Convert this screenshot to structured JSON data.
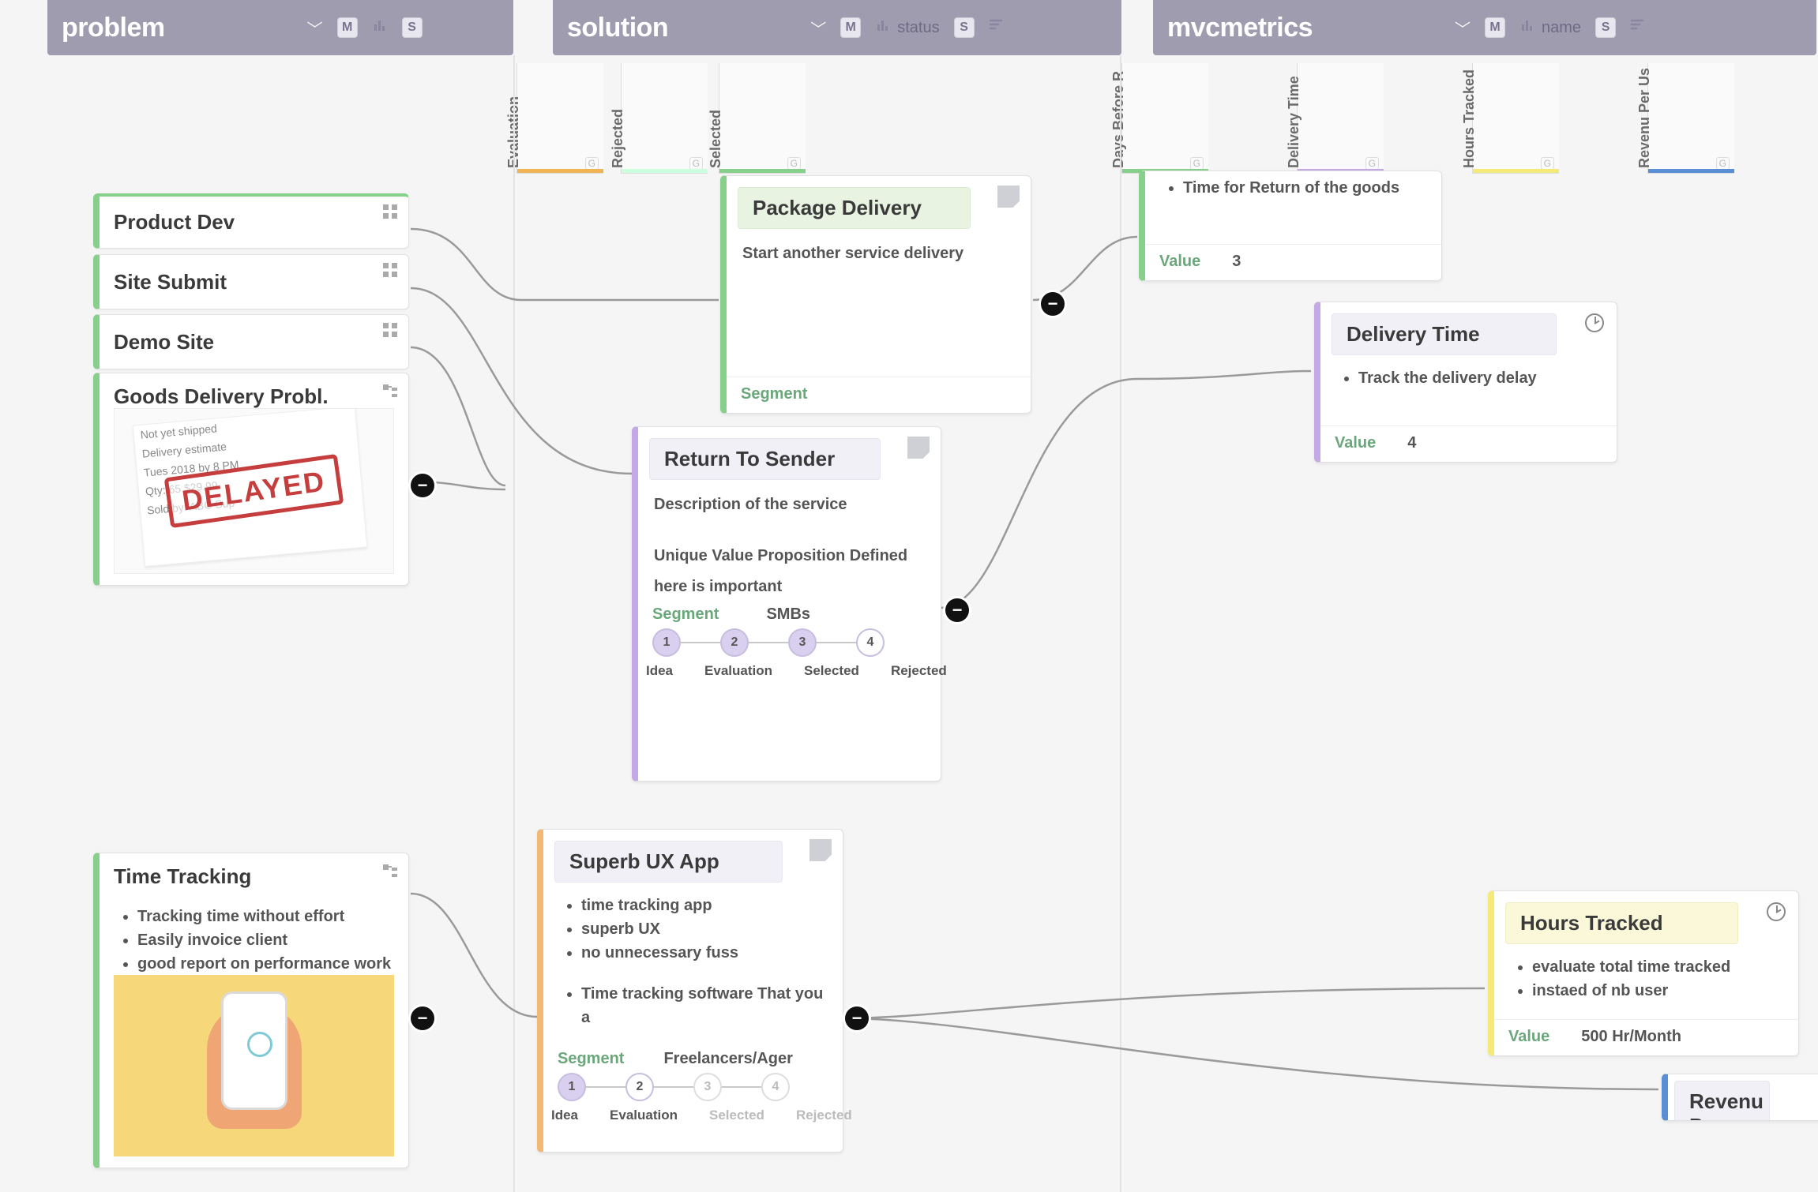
{
  "columns": {
    "problem": {
      "title": "problem",
      "badge_m": "M",
      "badge_s": "S"
    },
    "solution": {
      "title": "solution",
      "badge_m": "M",
      "badge_s": "S",
      "sort_label": "status"
    },
    "mvcmetrics": {
      "title": "mvcmetrics",
      "badge_m": "M",
      "badge_s": "S",
      "sort_label": "name"
    }
  },
  "sol_subcols": {
    "evaluation": "Evaluation",
    "rejected": "Rejected",
    "selected": "Selected"
  },
  "metric_subcols": {
    "days_before": "Days Before R",
    "delivery_time": "Delivery Time",
    "hours_tracked": "Hours Tracked",
    "revenu_per_user": "Revenu Per Us"
  },
  "problems": {
    "product_dev": "Product Dev",
    "site_submit": "Site Submit",
    "demo_site": "Demo Site",
    "goods_delivery": {
      "title": "Goods Delivery Probl.",
      "paper_lines": [
        "Not yet shipped",
        "Delivery estimate",
        "Tues 2018 by 8 PM",
        "Qty: 65   $29.99",
        "Sold by: ABC Sup"
      ],
      "stamp": "DELAYED"
    },
    "time_tracking": {
      "title": "Time Tracking",
      "bullets": [
        "Tracking time without effort",
        "Easily invoice client",
        "good report on performance work"
      ]
    }
  },
  "solutions": {
    "package_delivery": {
      "title": "Package Delivery",
      "text": "Start another service delivery",
      "segment_label": "Segment"
    },
    "return_to_sender": {
      "title": "Return To Sender",
      "desc": "Description of the service",
      "uvp": "Unique Value Proposition Defined",
      "note": "here is important",
      "segment_label": "Segment",
      "segment_value": "SMBs",
      "steps": [
        "1",
        "2",
        "3",
        "4"
      ],
      "step_labels": [
        "Idea",
        "Evaluation",
        "Selected",
        "Rejected"
      ]
    },
    "superb_ux": {
      "title": "Superb UX App",
      "bullets": [
        "time tracking app",
        "superb UX",
        "no unnecessary fuss"
      ],
      "extra_bullet": "Time tracking software That you a",
      "segment_label": "Segment",
      "segment_value": "Freelancers/Ager",
      "steps": [
        "1",
        "2",
        "3",
        "4"
      ],
      "step_labels": [
        "Idea",
        "Evaluation",
        "Selected",
        "Rejected"
      ]
    }
  },
  "metrics": {
    "time_for_return": {
      "bullet": "Time for Return of the goods",
      "value_label": "Value",
      "value": "3"
    },
    "delivery_time": {
      "title": "Delivery Time",
      "bullet": "Track the delivery delay",
      "value_label": "Value",
      "value": "4"
    },
    "hours_tracked": {
      "title": "Hours Tracked",
      "bullets": [
        "evaluate total time tracked",
        "instaed of nb user"
      ],
      "value_label": "Value",
      "value": "500 Hr/Month"
    },
    "revenu_per_user": {
      "title": "Revenu Per User"
    }
  },
  "knob": "−"
}
